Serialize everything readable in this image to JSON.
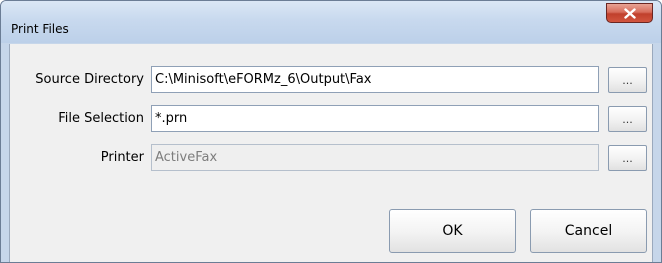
{
  "window": {
    "title": "Print Files"
  },
  "titlebar": {
    "close_icon": "close-icon",
    "close_color": "#c7402c"
  },
  "form": {
    "source_directory": {
      "label": "Source Directory",
      "value": "C:\\Minisoft\\eFORMz_6\\Output\\Fax",
      "browse_label": "..."
    },
    "file_selection": {
      "label": "File Selection",
      "value": "*.prn",
      "browse_label": "..."
    },
    "printer": {
      "label": "Printer",
      "value": "ActiveFax",
      "browse_label": "...",
      "disabled": true
    }
  },
  "buttons": {
    "ok_label": "OK",
    "cancel_label": "Cancel"
  }
}
